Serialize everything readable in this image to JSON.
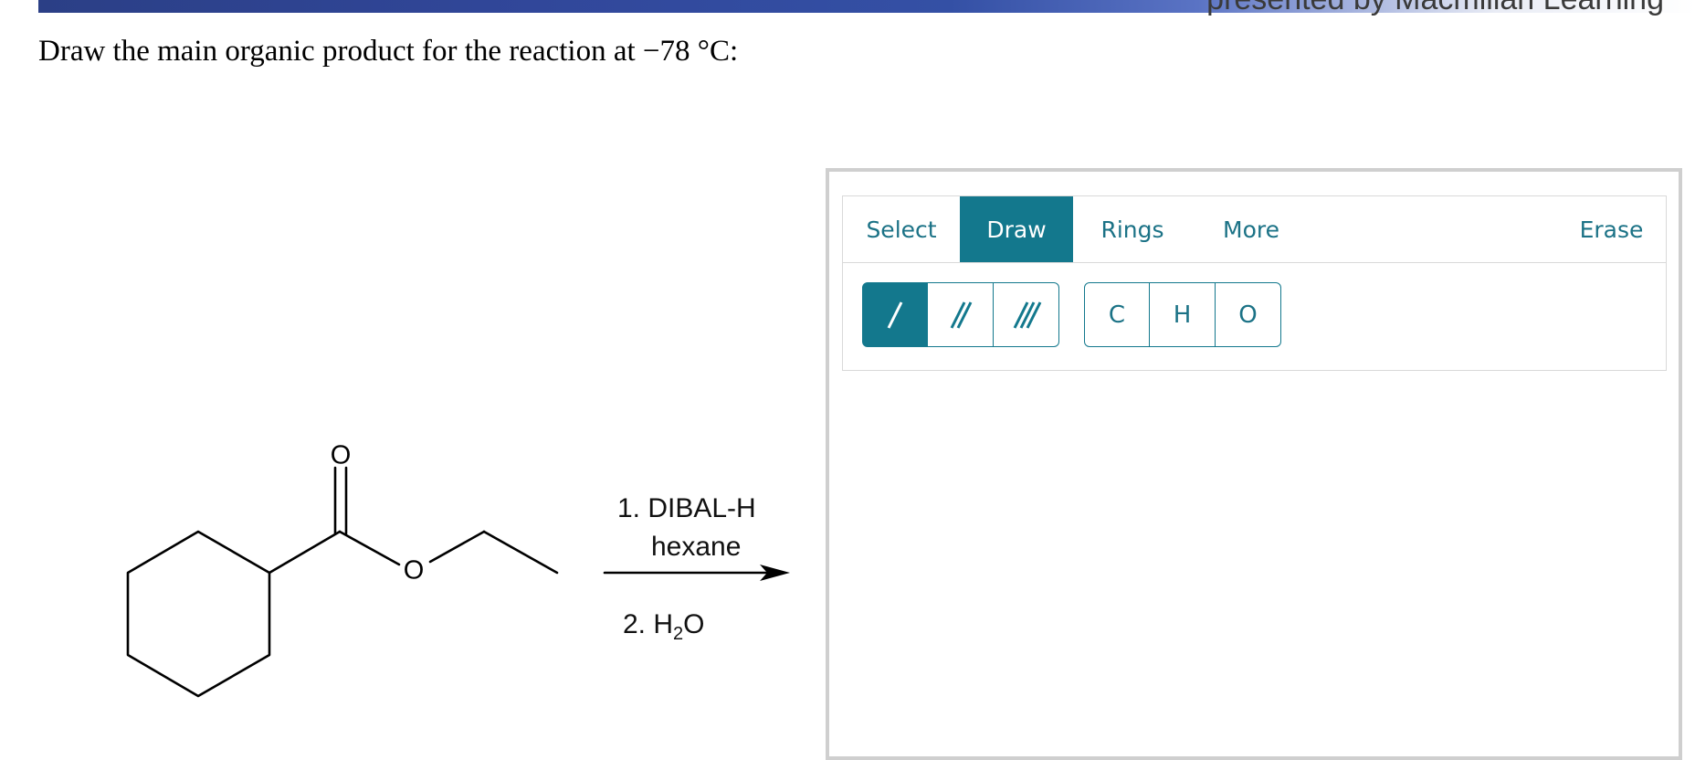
{
  "header": {
    "brand_text": "presented by Macmillan Learning"
  },
  "question": {
    "text": "Draw the main organic product for the reaction at −78 °C:"
  },
  "reaction": {
    "atom_labels": {
      "carbonyl_oxygen": "O",
      "ester_oxygen": "O"
    },
    "step1_line1": "1. DIBAL-H",
    "step1_line2": "hexane",
    "step2_prefix": "2. H",
    "step2_sub": "2",
    "step2_suffix": "O"
  },
  "editor": {
    "tabs": {
      "select": "Select",
      "draw": "Draw",
      "rings": "Rings",
      "more": "More",
      "erase": "Erase"
    },
    "active_tab": "Draw",
    "bond_tools": [
      "single-bond",
      "double-bond",
      "triple-bond"
    ],
    "active_bond_tool": "single-bond",
    "atoms": {
      "c": "C",
      "h": "H",
      "o": "O"
    },
    "accent_color": "#13788d"
  }
}
